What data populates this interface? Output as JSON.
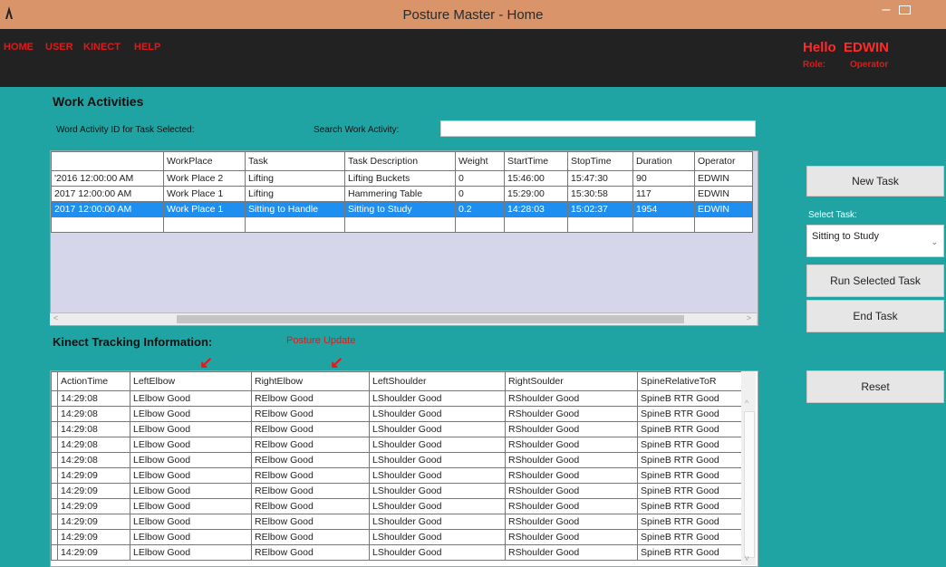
{
  "window": {
    "title": "Posture Master - Home"
  },
  "menu": {
    "items": [
      "HOME",
      "USER",
      "KINECT",
      "HELP"
    ]
  },
  "user": {
    "hello": "Hello  EDWIN",
    "role_label": "Role:",
    "role_value": "Operator"
  },
  "work": {
    "title": "Work Activities",
    "id_label": "Word Activity ID for Task Selected:",
    "search_label": "Search Work Activity:",
    "search_value": "",
    "columns": [
      "",
      "WorkPlace",
      "Task",
      "Task Description",
      "Weight",
      "StartTime",
      "StopTime",
      "Duration",
      "Operator"
    ],
    "rows": [
      [
        "'2016 12:00:00 AM",
        "Work Place 2",
        "Lifting",
        "Lifting Buckets",
        "0",
        "15:46:00",
        "15:47:30",
        "90",
        "EDWIN"
      ],
      [
        "2017 12:00:00 AM",
        "Work Place 1",
        "Lifting",
        "Hammering Table",
        "0",
        "15:29:00",
        "15:30:58",
        "117",
        "EDWIN"
      ],
      [
        "2017 12:00:00 AM",
        "Work Place 1",
        "Sitting to Handle",
        "Sitting to Study",
        "0.2",
        "14:28:03",
        "15:02:37",
        "1954",
        "EDWIN"
      ]
    ],
    "selected_row": 2
  },
  "kinect": {
    "title": "Kinect Tracking Information:",
    "posture_update": "Posture Update",
    "columns": [
      "ActionTime",
      "LeftElbow",
      "RightElbow",
      "LeftShoulder",
      "RightSoulder",
      "SpineRelativeToR"
    ],
    "rows": [
      [
        "14:29:08",
        "LElbow Good",
        "RElbow Good",
        "LShoulder Good",
        "RShoulder Good",
        "SpineB RTR Good"
      ],
      [
        "14:29:08",
        "LElbow Good",
        "RElbow Good",
        "LShoulder Good",
        "RShoulder Good",
        "SpineB RTR Good"
      ],
      [
        "14:29:08",
        "LElbow Good",
        "RElbow Good",
        "LShoulder Good",
        "RShoulder Good",
        "SpineB RTR Good"
      ],
      [
        "14:29:08",
        "LElbow Good",
        "RElbow Good",
        "LShoulder Good",
        "RShoulder Good",
        "SpineB RTR Good"
      ],
      [
        "14:29:08",
        "LElbow Good",
        "RElbow Good",
        "LShoulder Good",
        "RShoulder Good",
        "SpineB RTR Good"
      ],
      [
        "14:29:09",
        "LElbow Good",
        "RElbow Good",
        "LShoulder Good",
        "RShoulder Good",
        "SpineB RTR Good"
      ],
      [
        "14:29:09",
        "LElbow Good",
        "RElbow Good",
        "LShoulder Good",
        "RShoulder Good",
        "SpineB RTR Good"
      ],
      [
        "14:29:09",
        "LElbow Good",
        "RElbow Good",
        "LShoulder Good",
        "RShoulder Good",
        "SpineB RTR Good"
      ],
      [
        "14:29:09",
        "LElbow Good",
        "RElbow Good",
        "LShoulder Good",
        "RShoulder Good",
        "SpineB RTR Good"
      ],
      [
        "14:29:09",
        "LElbow Good",
        "RElbow Good",
        "LShoulder Good",
        "RShoulder Good",
        "SpineB RTR Good"
      ],
      [
        "14:29:09",
        "LElbow Good",
        "RElbow Good",
        "LShoulder Good",
        "RShoulder Good",
        "SpineB RTR Good"
      ]
    ]
  },
  "side": {
    "new_task": "New Task",
    "select_task_label": "Select Task:",
    "select_task_value": "Sitting to Study",
    "run_task": "Run Selected Task",
    "end_task": "End Task",
    "reset": "Reset"
  },
  "colors": {
    "background": "#20a3a3",
    "titlebar": "#d9946a",
    "menubar": "#222222",
    "accent_red": "#e01a1a",
    "selection": "#1e8ff0"
  },
  "icons": [
    "app-icon",
    "minimize-icon",
    "maximize-icon",
    "arrow-down-icon",
    "chevron-down-icon"
  ]
}
